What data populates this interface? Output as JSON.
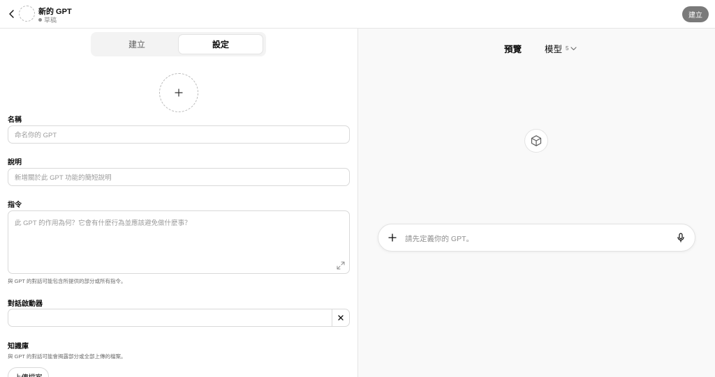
{
  "header": {
    "gpt_name": "新的 GPT",
    "status": "草稿",
    "create_button": "建立"
  },
  "tabs": [
    {
      "label": "建立",
      "active": false
    },
    {
      "label": "設定",
      "active": true
    }
  ],
  "form": {
    "name": {
      "label": "名稱",
      "placeholder": "命名你的 GPT"
    },
    "description": {
      "label": "說明",
      "placeholder": "新增關於此 GPT 功能的簡短說明"
    },
    "instructions": {
      "label": "指令",
      "placeholder": "此 GPT 的作用為何？它會有什麼行為並應該避免做什麼事？",
      "hint": "與 GPT 的對話可能包含所提供的部分或所有指令。"
    },
    "conversation_starters": {
      "label": "對話啟動器",
      "value": ""
    },
    "knowledge": {
      "label": "知識庫",
      "hint": "與 GPT 的對話可能會揭露部分或全部上傳的檔案。",
      "upload_button": "上傳檔案"
    }
  },
  "preview": {
    "title": "預覽",
    "model_label": "模型",
    "model_version": "5",
    "composer_placeholder": "請先定義你的 GPT。"
  },
  "icons": {
    "back": "chevron-left-icon",
    "avatar": "dashed-circle-avatar",
    "add_image": "plus-icon",
    "expand": "expand-icon",
    "clear": "close-icon",
    "model_dropdown": "chevron-down-icon",
    "gpt_placeholder": "cube-icon",
    "composer_add": "plus-icon",
    "mic": "microphone-icon"
  },
  "colors": {
    "create_button_bg": "#7a7a7a",
    "preview_bg": "#f9f9f9",
    "border": "#d9d9d9"
  }
}
